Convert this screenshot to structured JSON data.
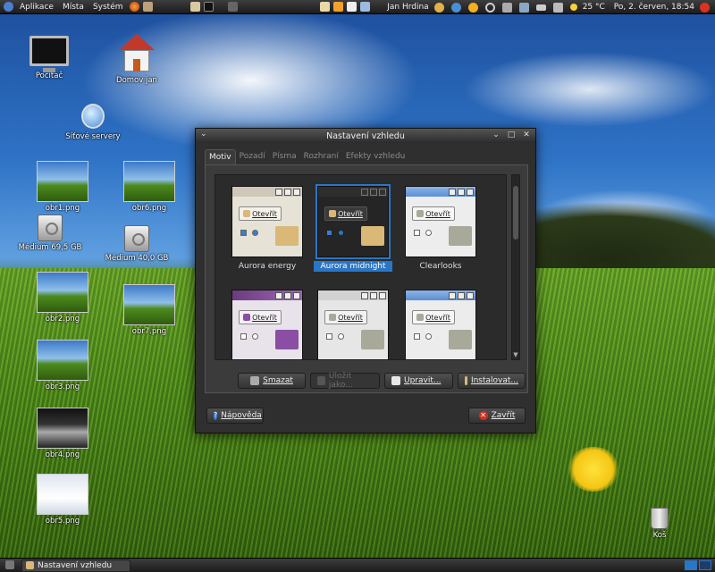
{
  "top_panel": {
    "menus": [
      "Aplikace",
      "Místa",
      "Systém"
    ],
    "user": "Jan Hrdina",
    "temperature": "25 °C",
    "datetime": "Po,  2. červen, 18:54"
  },
  "desktop_icons": [
    {
      "label": "Počítač",
      "kind": "computer-icon"
    },
    {
      "label": "Domov jan",
      "kind": "home-folder-icon"
    },
    {
      "label": "Síťové servery",
      "kind": "network-icon"
    },
    {
      "label": "obr1.png",
      "kind": "image-thumbnail"
    },
    {
      "label": "obr6.png",
      "kind": "image-thumbnail"
    },
    {
      "label": "Médium 69,5 GB",
      "kind": "drive-icon"
    },
    {
      "label": "Médium 40,0 GB",
      "kind": "drive-icon"
    },
    {
      "label": "obr2.png",
      "kind": "image-thumbnail"
    },
    {
      "label": "obr7.png",
      "kind": "image-thumbnail"
    },
    {
      "label": "obr3.png",
      "kind": "image-thumbnail"
    },
    {
      "label": "obr4.png",
      "kind": "image-thumbnail"
    },
    {
      "label": "obr5.png",
      "kind": "image-thumbnail"
    },
    {
      "label": "Koš",
      "kind": "trash-icon"
    }
  ],
  "dialog": {
    "title": "Nastavení vzhledu",
    "tabs": [
      "Motiv",
      "Pozadí",
      "Písma",
      "Rozhraní",
      "Efekty vzhledu"
    ],
    "active_tab": "Motiv",
    "themes": [
      {
        "label": "Aurora energy",
        "selected": false
      },
      {
        "label": "Aurora midnight",
        "selected": true
      },
      {
        "label": "Clearlooks",
        "selected": false
      },
      {
        "label": "",
        "selected": false
      },
      {
        "label": "",
        "selected": false
      },
      {
        "label": "",
        "selected": false
      }
    ],
    "preview_button_label": "Otevřít",
    "buttons": {
      "delete": "Smazat",
      "save_as": "Uložit jako...",
      "customize": "Upravit...",
      "install": "Instalovat..."
    },
    "help": "Nápověda",
    "close": "Zavřít"
  },
  "taskbar": {
    "task": "Nastavení vzhledu"
  }
}
